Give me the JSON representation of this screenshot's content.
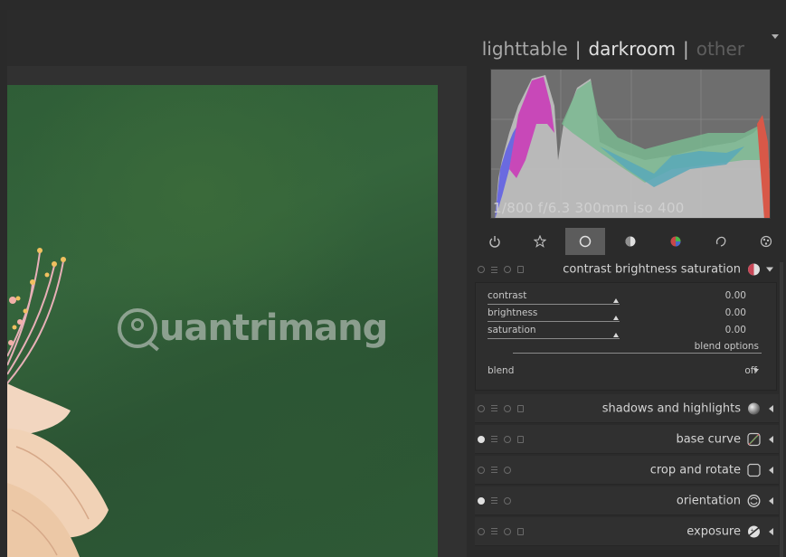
{
  "views": {
    "lighttable": "lighttable",
    "darkroom": "darkroom",
    "other": "other",
    "separator": "|"
  },
  "histogram": {
    "exif": "1/800 f/6.3 300mm iso 400"
  },
  "group_tabs": [
    "power-icon",
    "star-icon",
    "circle-icon",
    "half-circle-icon",
    "color-icon",
    "correct-icon",
    "effect-icon"
  ],
  "active_group": 2,
  "expanded_module": {
    "name": "contrast brightness saturation",
    "sliders": [
      {
        "label": "contrast",
        "value": "0.00"
      },
      {
        "label": "brightness",
        "value": "0.00"
      },
      {
        "label": "saturation",
        "value": "0.00"
      }
    ],
    "blend_options": "blend options",
    "blend_label": "blend",
    "blend_value": "off"
  },
  "modules": [
    {
      "name": "shadows and highlights",
      "enabled": false,
      "icon": "sphere-icon"
    },
    {
      "name": "base curve",
      "enabled": true,
      "icon": "curve-icon"
    },
    {
      "name": "crop and rotate",
      "enabled": false,
      "icon": "crop-icon"
    },
    {
      "name": "orientation",
      "enabled": true,
      "icon": "orientation-icon"
    },
    {
      "name": "exposure",
      "enabled": false,
      "icon": "exposure-icon"
    }
  ],
  "watermark": "uantrimang",
  "colors": {
    "accent_bg": "#2b2b2b",
    "active_tab": "#5c5c5c",
    "photo_green": "#2f5e37"
  }
}
